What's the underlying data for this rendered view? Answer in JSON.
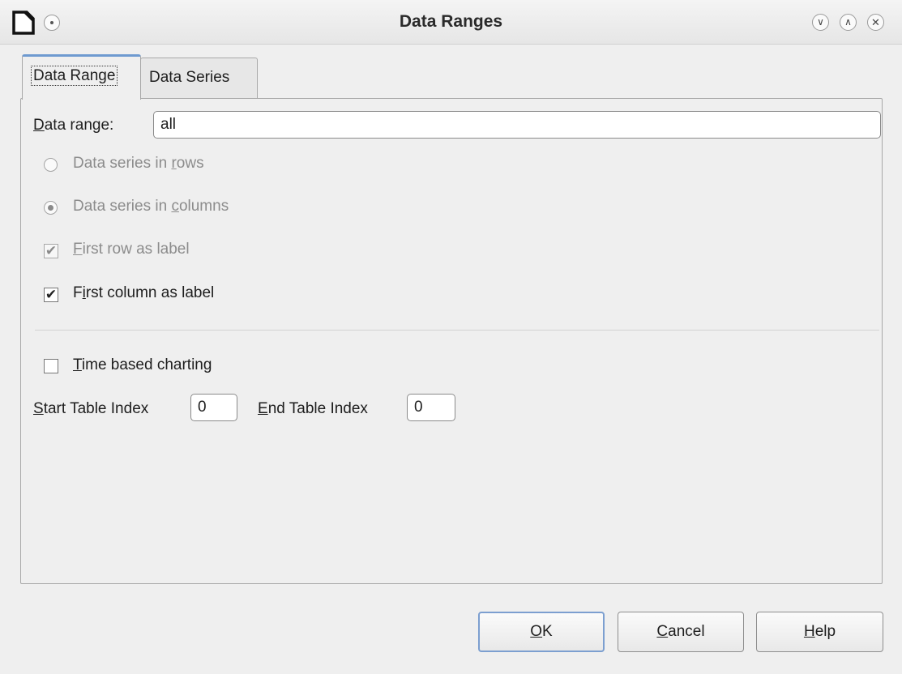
{
  "window": {
    "title": "Data Ranges",
    "app_icon": "document-icon",
    "controls": [
      "minimize",
      "maximize",
      "close"
    ]
  },
  "tabs": [
    {
      "label": "Data Range",
      "active": true
    },
    {
      "label": "Data Series",
      "active": false
    }
  ],
  "data_range": {
    "label_first": "D",
    "label_rest": "ata range:",
    "value": "all"
  },
  "options": {
    "rows": {
      "pre": "Data series in ",
      "u": "r",
      "post": "ows",
      "checked": false,
      "enabled": false
    },
    "columns": {
      "pre": "Data series in ",
      "u": "c",
      "post": "olumns",
      "checked": true,
      "enabled": false
    },
    "first_row": {
      "pre": "",
      "u": "F",
      "post": "irst row as label",
      "checked": true,
      "enabled": false
    },
    "first_column": {
      "pre": "F",
      "u": "i",
      "post": "rst column as label",
      "checked": true,
      "enabled": true
    }
  },
  "time_based": {
    "u": "T",
    "post": "ime based charting",
    "checked": false,
    "start_u": "S",
    "start_post": "tart Table Index",
    "start_value": "0",
    "end_u": "E",
    "end_post": "nd Table Index",
    "end_value": "0"
  },
  "buttons": {
    "ok_u": "O",
    "ok_post": "K",
    "cancel_u": "C",
    "cancel_post": "ancel",
    "help_u": "H",
    "help_post": "elp"
  },
  "colors": {
    "accent": "#6e9ad0",
    "background": "#efefef",
    "disabled_text": "#8c8c8c"
  }
}
